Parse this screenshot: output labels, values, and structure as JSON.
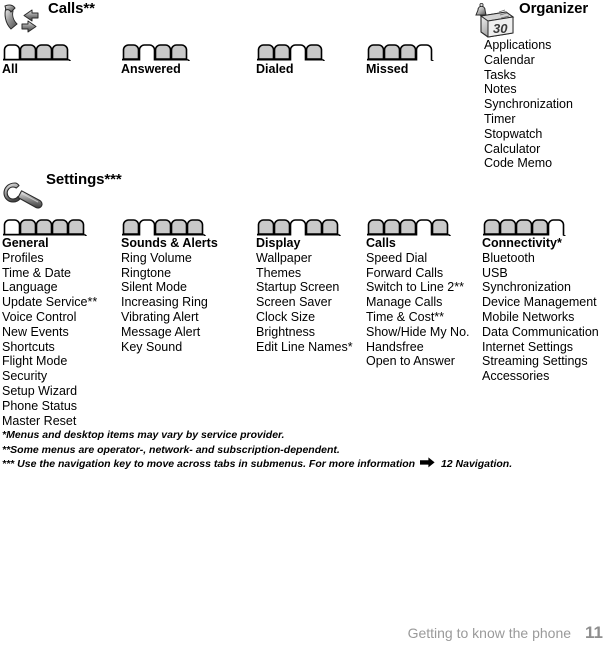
{
  "page": {
    "footer_label": "Getting to know the phone",
    "footer_page_number": "11"
  },
  "sections": [
    {
      "name": "calls",
      "title": "Calls**",
      "icon": "phone-call-arrows-icon",
      "tab_groups": [
        {
          "caption": "All",
          "tab_count": 4,
          "selected_index": 0
        },
        {
          "caption": "Answered",
          "tab_count": 4,
          "selected_index": 1
        },
        {
          "caption": "Dialed",
          "tab_count": 4,
          "selected_index": 2
        },
        {
          "caption": "Missed",
          "tab_count": 4,
          "selected_index": 3
        }
      ]
    },
    {
      "name": "organizer",
      "title": "Organizer",
      "icon": "calendar-alarm-clock-icon",
      "items": [
        "Applications",
        "Calendar",
        "Tasks",
        "Notes",
        "Synchronization",
        "Timer",
        "Stopwatch",
        "Calculator",
        "Code Memo"
      ]
    },
    {
      "name": "settings",
      "title": "Settings***",
      "icon": "wrench-icon",
      "columns": [
        {
          "header": "General",
          "tab_count": 5,
          "selected_index": 0,
          "items": [
            "Profiles",
            "Time & Date",
            "Language",
            "Update Service**",
            "Voice Control",
            "New Events",
            "Shortcuts",
            "Flight Mode",
            "Security",
            "Setup Wizard",
            "Phone Status",
            "Master Reset"
          ]
        },
        {
          "header": "Sounds & Alerts",
          "tab_count": 5,
          "selected_index": 1,
          "items": [
            "Ring Volume",
            "Ringtone",
            "Silent Mode",
            "Increasing Ring",
            "Vibrating Alert",
            "Message Alert",
            "Key Sound"
          ]
        },
        {
          "header": "Display",
          "tab_count": 5,
          "selected_index": 2,
          "items": [
            "Wallpaper",
            "Themes",
            "Startup Screen",
            "Screen Saver",
            "Clock Size",
            "Brightness",
            "Edit Line Names*"
          ]
        },
        {
          "header": "Calls",
          "tab_count": 5,
          "selected_index": 3,
          "items": [
            "Speed Dial",
            "Forward Calls",
            "Switch to Line 2**",
            "Manage Calls",
            "Time & Cost**",
            "Show/Hide My No.",
            "Handsfree",
            "Open to Answer"
          ]
        },
        {
          "header": "Connectivity*",
          "tab_count": 5,
          "selected_index": 4,
          "items": [
            "Bluetooth",
            "USB",
            "Synchronization",
            "Device Management",
            "Mobile Networks",
            "Data Communication",
            "Internet Settings",
            "Streaming Settings",
            "Accessories"
          ]
        }
      ]
    }
  ],
  "footnotes": {
    "one": "*Menus and desktop items may vary by service provider.",
    "two": "**Some menus are operator-, network- and subscription-dependent.",
    "three_before": "*** Use the navigation key to move across tabs in submenus. For more information",
    "three_after": "12 Navigation."
  },
  "colors": {
    "tab_fill_unselected": "#c9c9c9",
    "tab_fill_selected": "#ffffff",
    "tab_stroke": "#000000",
    "footer_text": "#9a9a9a",
    "text": "#000000"
  }
}
